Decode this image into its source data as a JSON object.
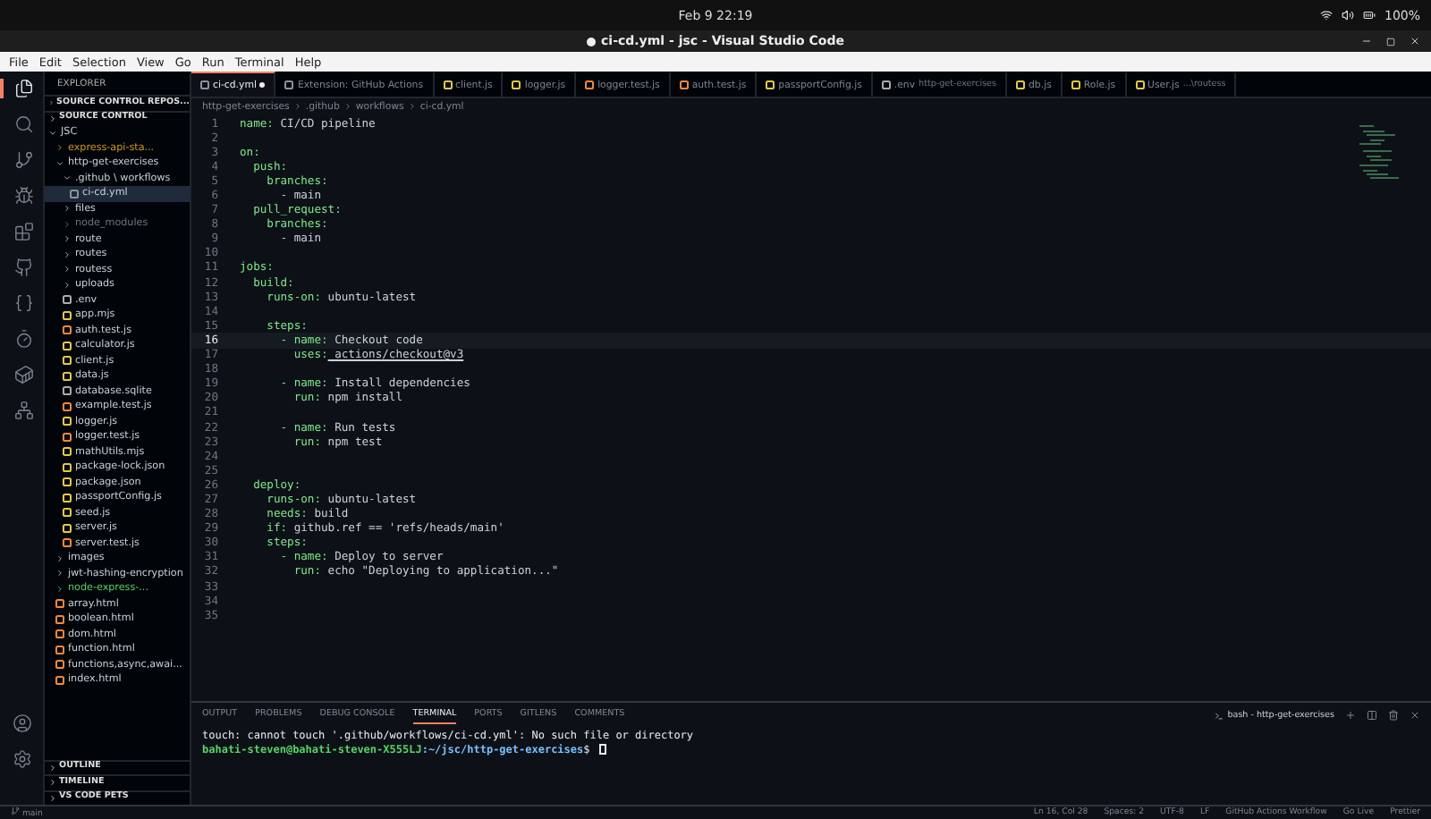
{
  "system_bar": {
    "clock": "Feb 9 22:19",
    "battery": "100%"
  },
  "window": {
    "title": "ci-cd.yml - jsc - Visual Studio Code",
    "dirty": true
  },
  "menu": [
    "File",
    "Edit",
    "Selection",
    "View",
    "Go",
    "Run",
    "Terminal",
    "Help"
  ],
  "activity_bar": [
    {
      "kind": "files",
      "selected": true
    },
    {
      "kind": "search",
      "selected": false
    },
    {
      "kind": "git",
      "selected": false
    },
    {
      "kind": "debug",
      "selected": false
    },
    {
      "kind": "extensions",
      "selected": false
    },
    {
      "kind": "github",
      "selected": false
    },
    {
      "kind": "braces",
      "selected": false
    },
    {
      "kind": "timer",
      "selected": false
    },
    {
      "kind": "docker",
      "selected": false
    },
    {
      "kind": "remote",
      "selected": false
    }
  ],
  "sidebar": {
    "title": "EXPLORER",
    "sections_top": [
      {
        "label": "SOURCE CONTROL REPOS..."
      },
      {
        "label": "SOURCE CONTROL"
      }
    ],
    "tree": [
      {
        "label": "JSC",
        "kind": "root",
        "expanded": true,
        "children": [
          {
            "label": "express-api-sta...",
            "kind": "folder",
            "expanded": false,
            "color": "#d29922"
          },
          {
            "label": "http-get-exercises",
            "kind": "folder",
            "expanded": true,
            "children": [
              {
                "label": ".github \\ workflows",
                "kind": "folder",
                "expanded": true,
                "children": [
                  {
                    "label": "ci-cd.yml",
                    "kind": "yml",
                    "selected": true
                  }
                ]
              },
              {
                "label": "files",
                "kind": "folder",
                "expanded": false
              },
              {
                "label": "node_modules",
                "kind": "folder",
                "expanded": false,
                "color": "#6e7681"
              },
              {
                "label": "route",
                "kind": "folder",
                "expanded": false
              },
              {
                "label": "routes",
                "kind": "folder",
                "expanded": false
              },
              {
                "label": "routess",
                "kind": "folder",
                "expanded": false
              },
              {
                "label": "uploads",
                "kind": "folder",
                "expanded": false
              },
              {
                "label": ".env",
                "kind": "env"
              },
              {
                "label": "app.mjs",
                "kind": "js"
              },
              {
                "label": "auth.test.js",
                "kind": "test"
              },
              {
                "label": "calculator.js",
                "kind": "js"
              },
              {
                "label": "client.js",
                "kind": "js"
              },
              {
                "label": "data.js",
                "kind": "js"
              },
              {
                "label": "database.sqlite",
                "kind": "db"
              },
              {
                "label": "example.test.js",
                "kind": "test"
              },
              {
                "label": "logger.js",
                "kind": "js"
              },
              {
                "label": "logger.test.js",
                "kind": "test"
              },
              {
                "label": "mathUtils.mjs",
                "kind": "js"
              },
              {
                "label": "package-lock.json",
                "kind": "json"
              },
              {
                "label": "package.json",
                "kind": "json"
              },
              {
                "label": "passportConfig.js",
                "kind": "js"
              },
              {
                "label": "seed.js",
                "kind": "js"
              },
              {
                "label": "server.js",
                "kind": "js"
              },
              {
                "label": "server.test.js",
                "kind": "test"
              }
            ]
          },
          {
            "label": "images",
            "kind": "folder",
            "expanded": false
          },
          {
            "label": "jwt-hashing-encryption",
            "kind": "folder",
            "expanded": false
          },
          {
            "label": "node-express-...",
            "kind": "folder",
            "expanded": false,
            "color": "#56d364"
          },
          {
            "label": "array.html",
            "kind": "html"
          },
          {
            "label": "boolean.html",
            "kind": "html"
          },
          {
            "label": "dom.html",
            "kind": "html"
          },
          {
            "label": "function.html",
            "kind": "html"
          },
          {
            "label": "functions,async,awai...",
            "kind": "html"
          },
          {
            "label": "index.html",
            "kind": "html"
          }
        ]
      }
    ],
    "sections_bottom": [
      {
        "label": "OUTLINE"
      },
      {
        "label": "TIMELINE"
      },
      {
        "label": "VS CODE PETS"
      }
    ]
  },
  "tabs": [
    {
      "label": "ci-cd.yml",
      "kind": "yml",
      "selected": true,
      "dirty": true
    },
    {
      "label": "Extension: GitHub Actions",
      "kind": "ext",
      "selected": false,
      "dirty": false
    },
    {
      "label": "client.js",
      "kind": "js",
      "selected": false,
      "dirty": false
    },
    {
      "label": "logger.js",
      "kind": "js",
      "selected": false,
      "dirty": false
    },
    {
      "label": "logger.test.js",
      "kind": "test",
      "selected": false,
      "dirty": false
    },
    {
      "label": "auth.test.js",
      "kind": "test",
      "selected": false,
      "dirty": false
    },
    {
      "label": "passportConfig.js",
      "kind": "js",
      "selected": false,
      "dirty": false
    },
    {
      "label": ".env",
      "kind": "env",
      "selected": false,
      "dirty": false,
      "description": "http-get-exercises"
    },
    {
      "label": "db.js",
      "kind": "js",
      "selected": false,
      "dirty": false
    },
    {
      "label": "Role.js",
      "kind": "js",
      "selected": false,
      "dirty": false
    },
    {
      "label": "User.js",
      "kind": "js",
      "selected": false,
      "dirty": false,
      "description": "...\\routess"
    }
  ],
  "breadcrumb": [
    "http-get-exercises",
    ".github",
    "workflows",
    "ci-cd.yml"
  ],
  "code": [
    {
      "n": "1",
      "key": "name:",
      "value": " CI/CD pipeline"
    },
    {
      "n": "2"
    },
    {
      "n": "3",
      "key": "on:"
    },
    {
      "n": "4",
      "key": "  push:"
    },
    {
      "n": "5",
      "key": "    branches:"
    },
    {
      "n": "6",
      "value": "      - main"
    },
    {
      "n": "7",
      "key": "  pull_request:"
    },
    {
      "n": "8",
      "key": "    branches:"
    },
    {
      "n": "9",
      "value": "      - main"
    },
    {
      "n": "10"
    },
    {
      "n": "11",
      "key": "jobs:"
    },
    {
      "n": "12",
      "key": "  build:"
    },
    {
      "n": "13",
      "key": "    runs-on:",
      "value": " ubuntu-latest"
    },
    {
      "n": "14"
    },
    {
      "n": "15",
      "key": "    steps:"
    },
    {
      "n": "16",
      "key": "      - name:",
      "value": " Checkout code",
      "current": true
    },
    {
      "n": "17",
      "key": "        uses:",
      "value": " actions/checkout@v3",
      "link": true
    },
    {
      "n": "18"
    },
    {
      "n": "19",
      "key": "      - name:",
      "value": " Install dependencies"
    },
    {
      "n": "20",
      "key": "        run:",
      "value": " npm install"
    },
    {
      "n": "21"
    },
    {
      "n": "22",
      "key": "      - name:",
      "value": " Run tests"
    },
    {
      "n": "23",
      "key": "        run:",
      "value": " npm test"
    },
    {
      "n": "24"
    },
    {
      "n": "25"
    },
    {
      "n": "26",
      "key": "  deploy:"
    },
    {
      "n": "27",
      "key": "    runs-on:",
      "value": " ubuntu-latest"
    },
    {
      "n": "28",
      "key": "    needs:",
      "value": " build"
    },
    {
      "n": "29",
      "key": "    if:",
      "value": " github.ref == 'refs/heads/main'"
    },
    {
      "n": "30",
      "key": "    steps:"
    },
    {
      "n": "31",
      "key": "      - name:",
      "value": " Deploy to server"
    },
    {
      "n": "32",
      "key": "        run:",
      "value": " echo \"Deploying to application...\""
    },
    {
      "n": "33"
    },
    {
      "n": "34"
    },
    {
      "n": "35"
    }
  ],
  "panel": {
    "tabs": [
      {
        "label": "OUTPUT",
        "selected": false
      },
      {
        "label": "PROBLEMS",
        "selected": false
      },
      {
        "label": "DEBUG CONSOLE",
        "selected": false
      },
      {
        "label": "TERMINAL",
        "selected": true
      },
      {
        "label": "PORTS",
        "selected": false
      },
      {
        "label": "GITLENS",
        "selected": false
      },
      {
        "label": "COMMENTS",
        "selected": false
      }
    ],
    "terminal_name": "bash - http-get-exercises",
    "terminal_lines": [
      {
        "kind": "output",
        "text": "touch: cannot touch '.github/workflows/ci-cd.yml': No such file or directory"
      },
      {
        "kind": "prompt",
        "user": "bahati-steven@bahati-steven-X555LJ",
        "path": ":~/jsc/http-get-exercises",
        "symbol": "$"
      }
    ]
  },
  "status_bar": {
    "left": [
      "main"
    ],
    "right": [
      "Ln 16, Col 28",
      "Spaces: 2",
      "UTF-8",
      "LF",
      "GitHub Actions Workflow",
      "Go Live",
      "Prettier"
    ]
  }
}
